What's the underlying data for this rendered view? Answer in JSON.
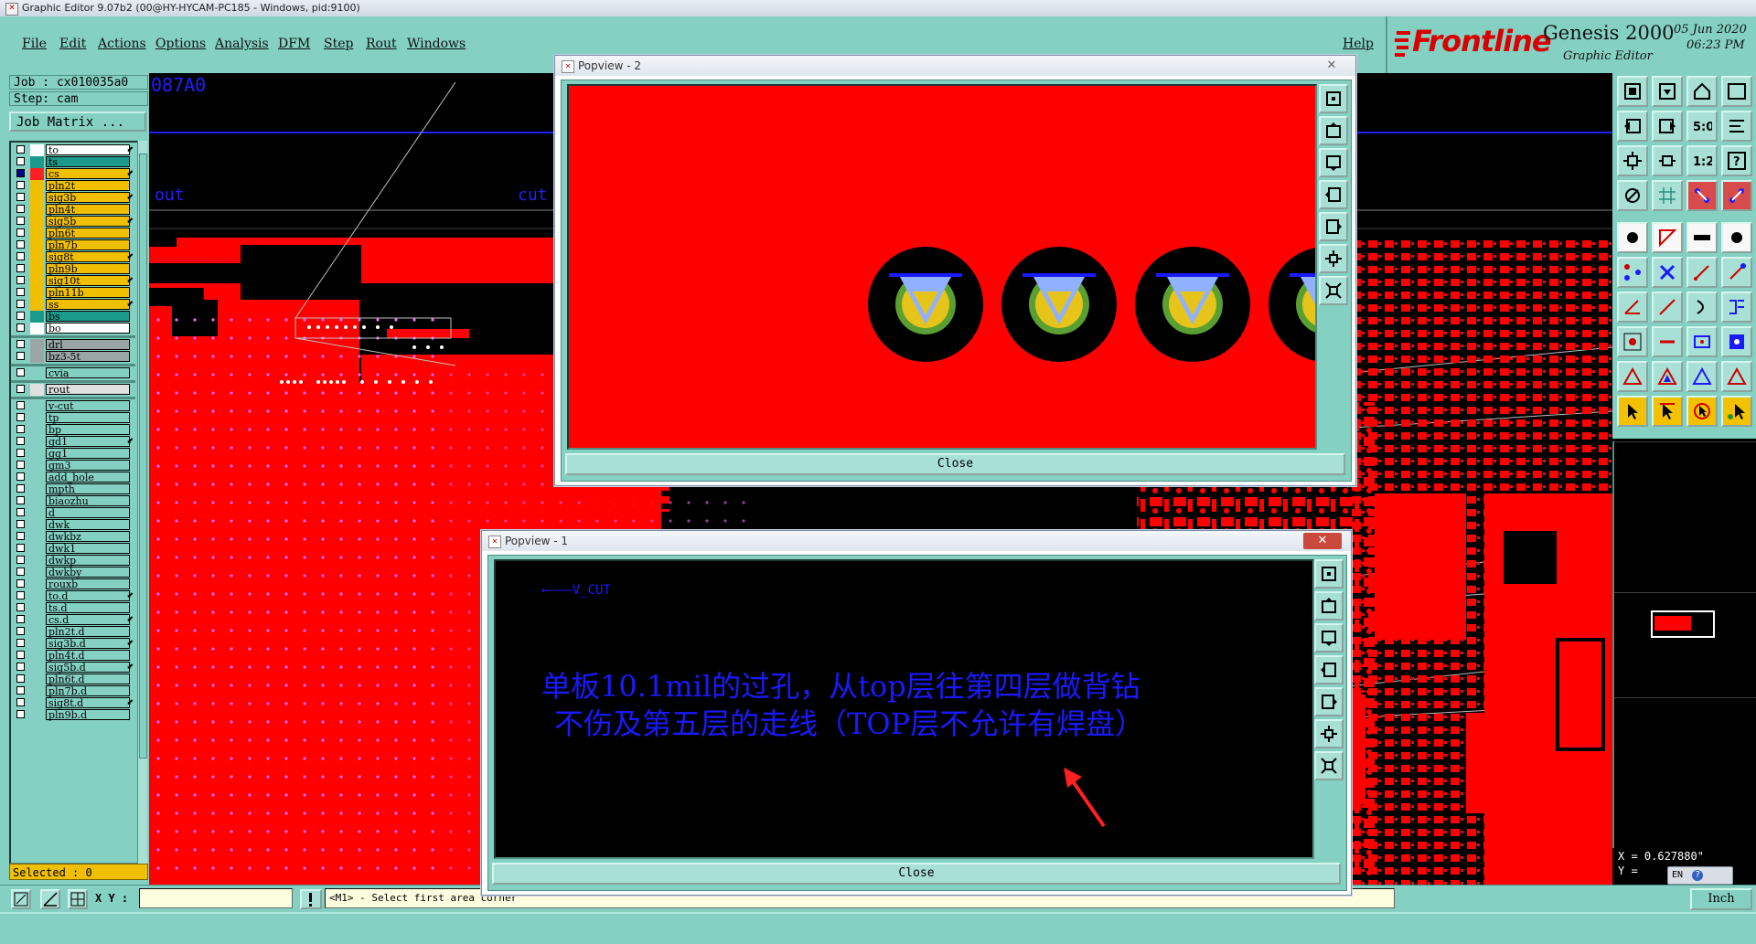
{
  "window": {
    "title": "Graphic Editor 9.07b2 (00@HY-HYCAM-PC185 - Windows, pid:9100)"
  },
  "menu": {
    "items": [
      "File",
      "Edit",
      "Actions",
      "Options",
      "Analysis",
      "DFM",
      "Step",
      "Rout",
      "Windows"
    ],
    "help": "Help"
  },
  "brand": {
    "logo": "Frontline",
    "product": "Genesis 2000",
    "subtitle": "Graphic Editor",
    "date": "05 Jun 2020",
    "time": "06:23 PM"
  },
  "job": {
    "job_line": "Job : cx010035a0",
    "step_line": "Step: cam",
    "matrix_button": "Job Matrix ..."
  },
  "layers": [
    {
      "name": "to",
      "color": "#ffffff",
      "fill": "#ffffff",
      "checked": false,
      "arrow": true
    },
    {
      "name": "ts",
      "color": "#1a9a8a",
      "fill": "#1a9a8a",
      "checked": false,
      "arrow": false
    },
    {
      "name": "cs",
      "color": "#ff2020",
      "fill": "#f0c000",
      "checked": true,
      "arrow": true
    },
    {
      "name": "pln2t",
      "color": "#f0c000",
      "fill": "#f0c000",
      "checked": false,
      "arrow": false
    },
    {
      "name": "sig3b",
      "color": "#f0c000",
      "fill": "#f0c000",
      "checked": false,
      "arrow": true
    },
    {
      "name": "pln4t",
      "color": "#f0c000",
      "fill": "#f0c000",
      "checked": false,
      "arrow": false
    },
    {
      "name": "sig5b",
      "color": "#f0c000",
      "fill": "#f0c000",
      "checked": false,
      "arrow": true
    },
    {
      "name": "pln6t",
      "color": "#f0c000",
      "fill": "#f0c000",
      "checked": false,
      "arrow": false
    },
    {
      "name": "pln7b",
      "color": "#f0c000",
      "fill": "#f0c000",
      "checked": false,
      "arrow": false
    },
    {
      "name": "sig8t",
      "color": "#f0c000",
      "fill": "#f0c000",
      "checked": false,
      "arrow": true
    },
    {
      "name": "pln9b",
      "color": "#f0c000",
      "fill": "#f0c000",
      "checked": false,
      "arrow": false
    },
    {
      "name": "sig10t",
      "color": "#f0c000",
      "fill": "#f0c000",
      "checked": false,
      "arrow": true
    },
    {
      "name": "pln11b",
      "color": "#f0c000",
      "fill": "#f0c000",
      "checked": false,
      "arrow": false
    },
    {
      "name": "ss",
      "color": "#f0c000",
      "fill": "#f0c000",
      "checked": false,
      "arrow": true
    },
    {
      "name": "bs",
      "color": "#1a9a8a",
      "fill": "#1a9a8a",
      "checked": false,
      "arrow": false
    },
    {
      "name": "bo",
      "color": "#ffffff",
      "fill": "#ffffff",
      "checked": false,
      "arrow": false
    },
    {
      "gap": true
    },
    {
      "name": "drl",
      "color": "#9aa5a5",
      "fill": "#9aa5a5",
      "checked": false,
      "arrow": false
    },
    {
      "name": "bz3-5t",
      "color": "#9aa5a5",
      "fill": "#9aa5a5",
      "checked": false,
      "arrow": false
    },
    {
      "gap": true
    },
    {
      "name": "cvia",
      "color": "#84d1c3",
      "fill": "#84d1c3",
      "checked": false,
      "arrow": false
    },
    {
      "gap": true
    },
    {
      "name": "rout",
      "color": "#e0e0e0",
      "fill": "#e0e0e0",
      "checked": false,
      "arrow": false
    },
    {
      "gap": true
    },
    {
      "name": "v-cut",
      "color": "#84d1c3",
      "fill": "#84d1c3",
      "checked": false,
      "arrow": false
    },
    {
      "name": "tp",
      "color": "#84d1c3",
      "fill": "#84d1c3",
      "checked": false,
      "arrow": false
    },
    {
      "name": "bp",
      "color": "#84d1c3",
      "fill": "#84d1c3",
      "checked": false,
      "arrow": false
    },
    {
      "name": "gd1",
      "color": "#84d1c3",
      "fill": "#84d1c3",
      "checked": false,
      "arrow": true
    },
    {
      "name": "gg1",
      "color": "#84d1c3",
      "fill": "#84d1c3",
      "checked": false,
      "arrow": false
    },
    {
      "name": "gm3",
      "color": "#84d1c3",
      "fill": "#84d1c3",
      "checked": false,
      "arrow": false
    },
    {
      "name": "add_hole",
      "color": "#84d1c3",
      "fill": "#84d1c3",
      "checked": false,
      "arrow": false
    },
    {
      "name": "mpth",
      "color": "#84d1c3",
      "fill": "#84d1c3",
      "checked": false,
      "arrow": false
    },
    {
      "name": "biaozhu",
      "color": "#84d1c3",
      "fill": "#84d1c3",
      "checked": false,
      "arrow": false
    },
    {
      "name": "d",
      "color": "#84d1c3",
      "fill": "#84d1c3",
      "checked": false,
      "arrow": false
    },
    {
      "name": "dwk",
      "color": "#84d1c3",
      "fill": "#84d1c3",
      "checked": false,
      "arrow": false
    },
    {
      "name": "dwkbz",
      "color": "#84d1c3",
      "fill": "#84d1c3",
      "checked": false,
      "arrow": false
    },
    {
      "name": "dwk1",
      "color": "#84d1c3",
      "fill": "#84d1c3",
      "checked": false,
      "arrow": false
    },
    {
      "name": "dwkp",
      "color": "#84d1c3",
      "fill": "#84d1c3",
      "checked": false,
      "arrow": false
    },
    {
      "name": "dwkby",
      "color": "#84d1c3",
      "fill": "#84d1c3",
      "checked": false,
      "arrow": false
    },
    {
      "name": "rouxb",
      "color": "#84d1c3",
      "fill": "#84d1c3",
      "checked": false,
      "arrow": false
    },
    {
      "name": "to.d",
      "color": "#84d1c3",
      "fill": "#84d1c3",
      "checked": false,
      "arrow": true
    },
    {
      "name": "ts.d",
      "color": "#84d1c3",
      "fill": "#84d1c3",
      "checked": false,
      "arrow": false
    },
    {
      "name": "cs.d",
      "color": "#84d1c3",
      "fill": "#84d1c3",
      "checked": false,
      "arrow": true
    },
    {
      "name": "pln2t.d",
      "color": "#84d1c3",
      "fill": "#84d1c3",
      "checked": false,
      "arrow": false
    },
    {
      "name": "sig3b.d",
      "color": "#84d1c3",
      "fill": "#84d1c3",
      "checked": false,
      "arrow": true
    },
    {
      "name": "pln4t.d",
      "color": "#84d1c3",
      "fill": "#84d1c3",
      "checked": false,
      "arrow": false
    },
    {
      "name": "sig5b.d",
      "color": "#84d1c3",
      "fill": "#84d1c3",
      "checked": false,
      "arrow": true
    },
    {
      "name": "pln6t.d",
      "color": "#84d1c3",
      "fill": "#84d1c3",
      "checked": false,
      "arrow": false
    },
    {
      "name": "pln7b.d",
      "color": "#84d1c3",
      "fill": "#84d1c3",
      "checked": false,
      "arrow": false
    },
    {
      "name": "sig8t.d",
      "color": "#84d1c3",
      "fill": "#84d1c3",
      "checked": false,
      "arrow": true
    },
    {
      "name": "pln9b.d",
      "color": "#84d1c3",
      "fill": "#84d1c3",
      "checked": false,
      "arrow": false
    }
  ],
  "selected": "Selected : 0",
  "status": {
    "xy_label": "X Y :",
    "xy_value": "",
    "message": "<M1> - Select first area corner",
    "unit": "Inch"
  },
  "coords": {
    "x": "X = 0.627880\"",
    "y": "Y =",
    "lang": "EN"
  },
  "canvas": {
    "labels": [
      "087A0",
      "out",
      "cut"
    ],
    "colors": {
      "copper": "#ff0000",
      "background": "#000000",
      "via_dot": "#ff66ff",
      "mark": "#2020ff"
    }
  },
  "popview2": {
    "title": "Popview - 2",
    "close": "Close",
    "vias": 4,
    "colors": {
      "fill": "#ff0000",
      "pad": "#000000",
      "ring": "#5a9f32",
      "inner": "#e6c419",
      "triangle": "#8fb1ff"
    }
  },
  "popview1": {
    "title": "Popview - 1",
    "close": "Close",
    "vcut_label": "←———V_CUT",
    "annotation_line1": "单板10.1mil的过孔，从top层往第四层做背钻",
    "annotation_line2": "不伤及第五层的走线（TOP层不允许有焊盘）",
    "colors": {
      "text": "#1a1aff",
      "arrow": "#ff2020"
    }
  }
}
